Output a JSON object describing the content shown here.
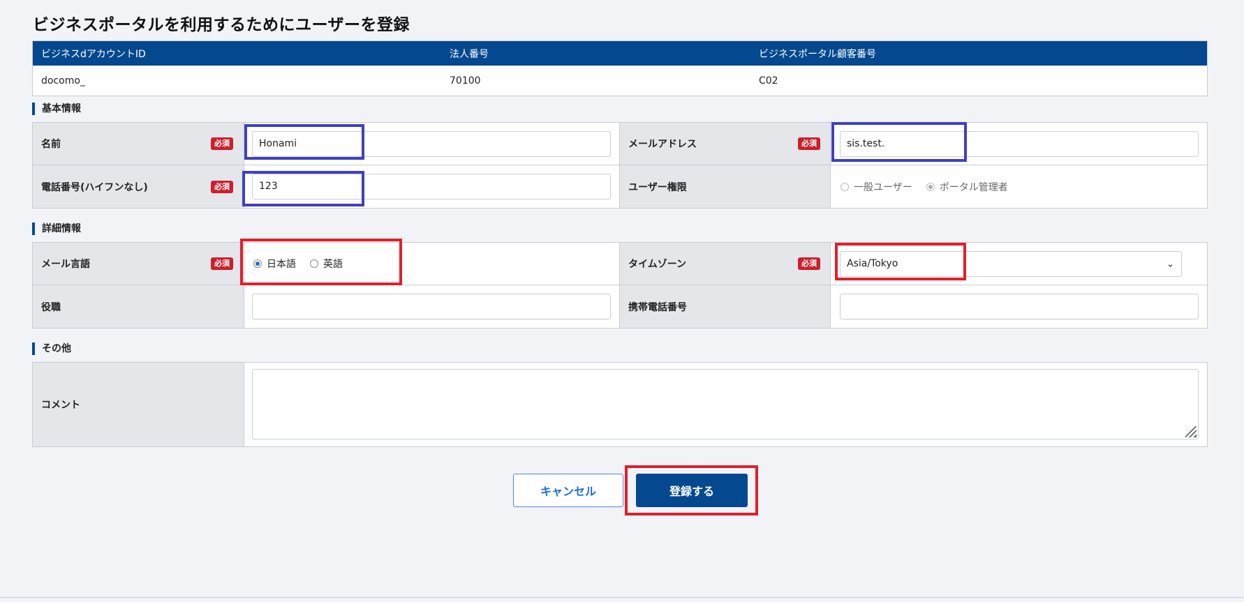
{
  "page": {
    "title": "ビジネスポータルを利用するためにユーザーを登録"
  },
  "account": {
    "headers": [
      "ビジネスdアカウントID",
      "法人番号",
      "ビジネスポータル顧客番号"
    ],
    "values": [
      "docomo_",
      "70100",
      "C02"
    ]
  },
  "required_label": "必須",
  "basic": {
    "heading": "基本情報",
    "name_label": "名前",
    "name_value": "Honami",
    "email_label": "メールアドレス",
    "email_value": "sis.test.",
    "phone_label": "電話番号(ハイフンなし)",
    "phone_value": "123",
    "role_label": "ユーザー権限",
    "role_options": [
      "一般ユーザー",
      "ポータル管理者"
    ],
    "role_selected": "ポータル管理者"
  },
  "detail": {
    "heading": "詳細情報",
    "lang_label": "メール言語",
    "lang_options": [
      "日本語",
      "英語"
    ],
    "lang_selected": "日本語",
    "tz_label": "タイムゾーン",
    "tz_value": "Asia/Tokyo",
    "position_label": "役職",
    "position_value": "",
    "mobile_label": "携帯電話番号",
    "mobile_value": ""
  },
  "other": {
    "heading": "その他",
    "comment_label": "コメント",
    "comment_value": ""
  },
  "buttons": {
    "cancel": "キャンセル",
    "submit": "登録する"
  },
  "icons": {
    "select_chevron": "chevron-down-icon",
    "resize": "resize-grip-icon"
  },
  "colors": {
    "header_bg": "#04498f",
    "required_badge": "#cc1f2c",
    "highlight_blue": "#3e3fc6",
    "highlight_red": "#e0202c"
  }
}
